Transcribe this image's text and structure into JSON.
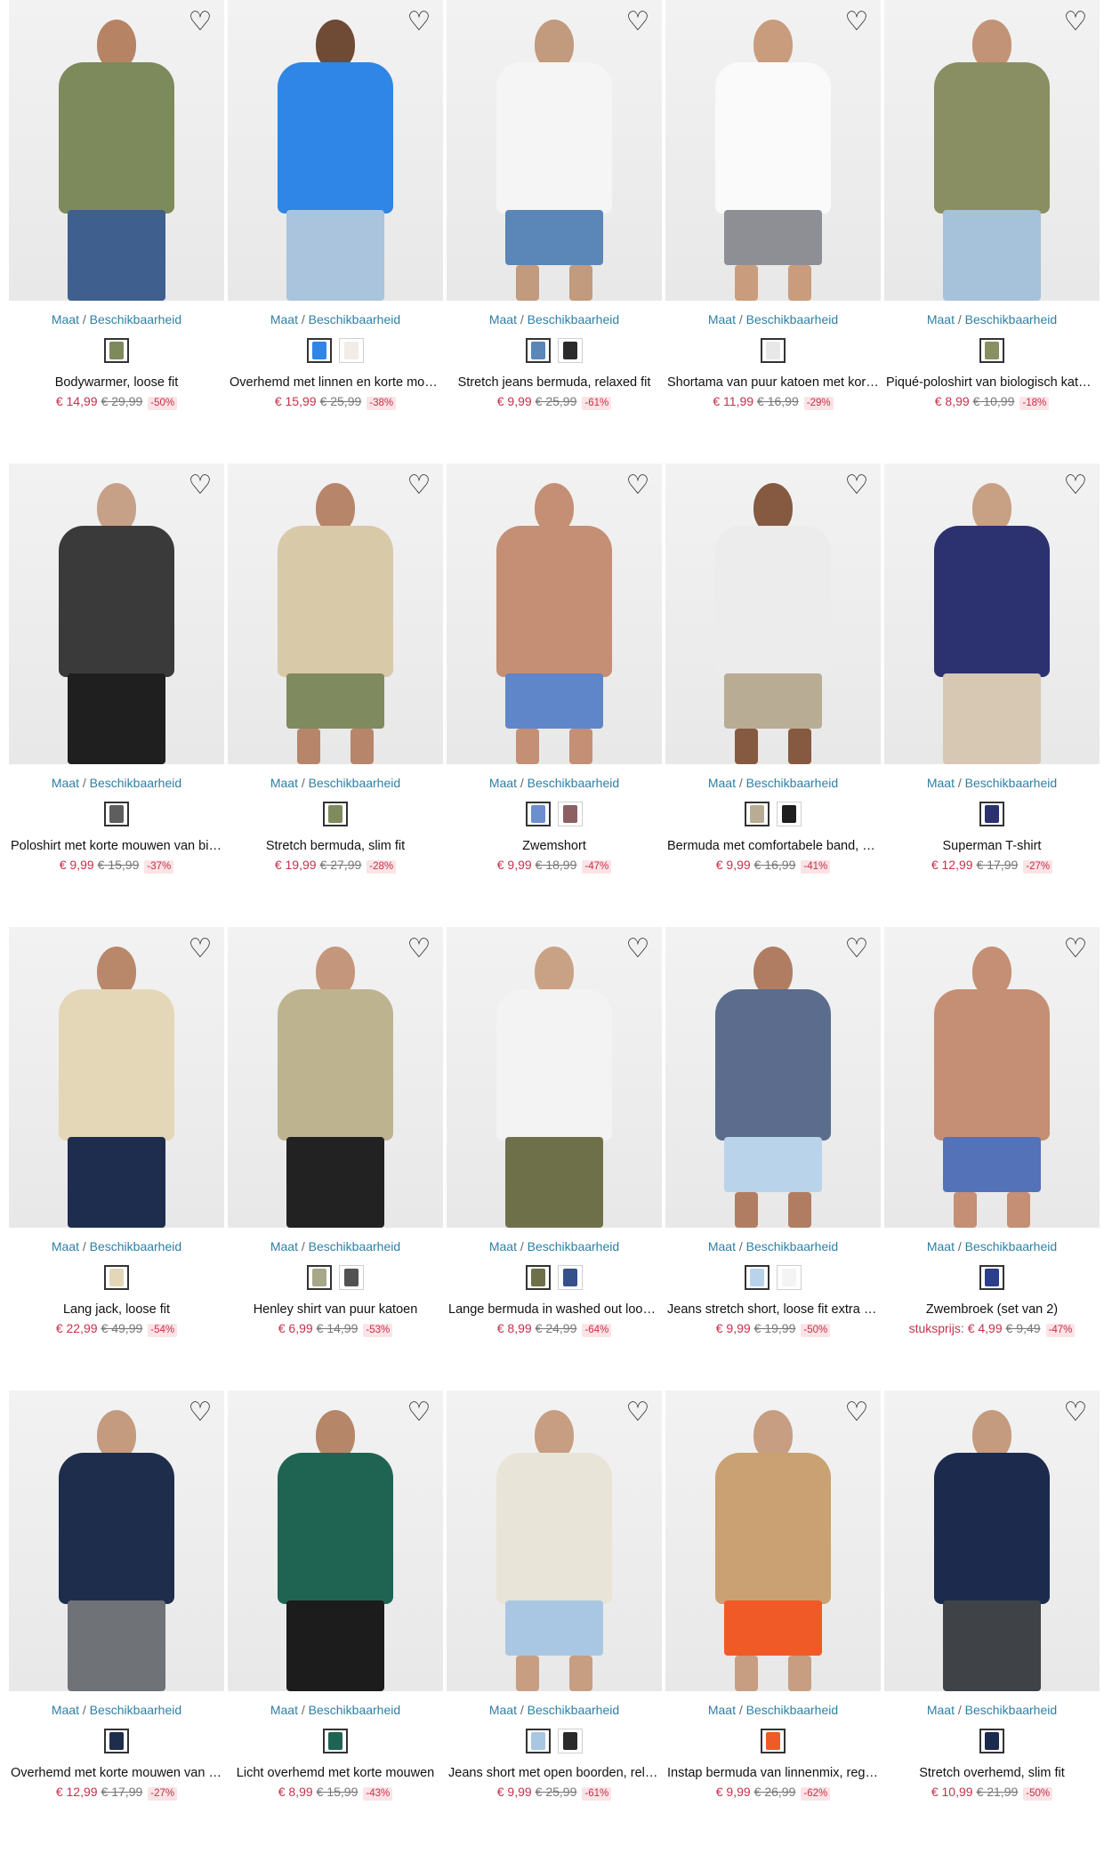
{
  "ui": {
    "size_link": "Maat",
    "size_sep": "/",
    "avail_link": "Beschikbaarheid",
    "currency": "€",
    "favorite_icon": "heart-outline-icon"
  },
  "products": [
    {
      "title": "Bodywarmer, loose fit",
      "price": "€ 14,99",
      "old": "€ 29,99",
      "disc": "-50%",
      "skin": "#b68465",
      "top": "#7d8a5c",
      "bottom": "#3f5f8f",
      "swatches": [
        "#7d8a5c"
      ]
    },
    {
      "title": "Overhemd met linnen en korte mouwen",
      "price": "€ 15,99",
      "old": "€ 25,99",
      "disc": "-38%",
      "skin": "#6f4a35",
      "top": "#2f86e6",
      "bottom": "#a9c4dc",
      "swatches": [
        "#2f86e6",
        "#f1ede6"
      ]
    },
    {
      "title": "Stretch jeans bermuda, relaxed fit",
      "price": "€ 9,99",
      "old": "€ 25,99",
      "disc": "-61%",
      "skin": "#c29a7d",
      "top": "#f5f5f5",
      "bottom": "#5a86b8",
      "swatches": [
        "#5a86b8",
        "#2b2b2b"
      ]
    },
    {
      "title": "Shortama van puur katoen met korte mouwen",
      "price": "€ 11,99",
      "old": "€ 16,99",
      "disc": "-29%",
      "skin": "#c99c7d",
      "top": "#fafafa",
      "bottom": "#8d8f94",
      "swatches": [
        "#e8e8e8"
      ]
    },
    {
      "title": "Piqué-poloshirt van biologisch katoen",
      "price": "€ 8,99",
      "old": "€ 10,99",
      "disc": "-18%",
      "skin": "#c39378",
      "top": "#8a8f63",
      "bottom": "#a6c1da",
      "swatches": [
        "#8a8f63"
      ]
    },
    {
      "title": "Poloshirt met korte mouwen van biologisch katoen",
      "price": "€ 9,99",
      "old": "€ 15,99",
      "disc": "-37%",
      "skin": "#c7a088",
      "top": "#3a3a3a",
      "bottom": "#1f1f1f",
      "swatches": [
        "#5e5e5e"
      ]
    },
    {
      "title": "Stretch bermuda, slim fit",
      "price": "€ 19,99",
      "old": "€ 27,99",
      "disc": "-28%",
      "skin": "#b7856a",
      "top": "#d8c9a8",
      "bottom": "#7f8a5e",
      "swatches": [
        "#7f8a5e"
      ]
    },
    {
      "title": "Zwemshort",
      "price": "€ 9,99",
      "old": "€ 18,99",
      "disc": "-47%",
      "skin": "#c48f74",
      "top": "#c48f74",
      "bottom": "#5f86c8",
      "swatches": [
        "#6e8fcd",
        "#8c5f63"
      ]
    },
    {
      "title": "Bermuda met comfortabele band, regular fit",
      "price": "€ 9,99",
      "old": "€ 16,99",
      "disc": "-41%",
      "skin": "#855a40",
      "top": "#ececec",
      "bottom": "#b8ac94",
      "swatches": [
        "#b8ac94",
        "#1e1e1e"
      ]
    },
    {
      "title": "Superman T-shirt",
      "price": "€ 12,99",
      "old": "€ 17,99",
      "disc": "-27%",
      "skin": "#c8a084",
      "top": "#2c3170",
      "bottom": "#d6c8b2",
      "swatches": [
        "#2c3170"
      ]
    },
    {
      "title": "Lang jack, loose fit",
      "price": "€ 22,99",
      "old": "€ 49,99",
      "disc": "-54%",
      "skin": "#b9876a",
      "top": "#e4d7b8",
      "bottom": "#1e2c4e",
      "swatches": [
        "#e4d7b8"
      ]
    },
    {
      "title": "Henley shirt van puur katoen",
      "price": "€ 6,99",
      "old": "€ 14,99",
      "disc": "-53%",
      "skin": "#c4977c",
      "top": "#bdb48f",
      "bottom": "#222222",
      "swatches": [
        "#a7a78a",
        "#525252"
      ]
    },
    {
      "title": "Lange bermuda in washed out look, regular fit",
      "price": "€ 8,99",
      "old": "€ 24,99",
      "disc": "-64%",
      "skin": "#c9a286",
      "top": "#f3f3f3",
      "bottom": "#6e7049",
      "swatches": [
        "#6e7049",
        "#35508a"
      ]
    },
    {
      "title": "Jeans stretch short, loose fit extra wijd",
      "price": "€ 9,99",
      "old": "€ 19,99",
      "disc": "-50%",
      "skin": "#b17d62",
      "top": "#5b6c8d",
      "bottom": "#b8d3ea",
      "swatches": [
        "#b8d3ea",
        "#f4f4f4"
      ]
    },
    {
      "title": "Zwembroek (set van 2)",
      "price": "€ 4,99",
      "old": "€ 9,49",
      "disc": "-47%",
      "unit": "stuksprijs:",
      "skin": "#c48f74",
      "top": "#c48f74",
      "bottom": "#5472b8",
      "swatches": [
        "#2b3f8a"
      ]
    },
    {
      "title": "Overhemd met korte mouwen van puur katoen",
      "price": "€ 12,99",
      "old": "€ 17,99",
      "disc": "-27%",
      "skin": "#c49b7e",
      "top": "#1f2d4c",
      "bottom": "#6f7276",
      "swatches": [
        "#1f2d4c"
      ]
    },
    {
      "title": "Licht overhemd met korte mouwen",
      "price": "€ 8,99",
      "old": "€ 15,99",
      "disc": "-43%",
      "skin": "#b68668",
      "top": "#1f6453",
      "bottom": "#1c1c1c",
      "swatches": [
        "#1f6453"
      ]
    },
    {
      "title": "Jeans short met open boorden, relaxed fit",
      "price": "€ 9,99",
      "old": "€ 25,99",
      "disc": "-61%",
      "skin": "#c79e82",
      "top": "#e9e4d8",
      "bottom": "#a9c7e2",
      "swatches": [
        "#a9c7e2",
        "#2a2a2a"
      ]
    },
    {
      "title": "Instap bermuda van linnenmix, regular fit",
      "price": "€ 9,99",
      "old": "€ 26,99",
      "disc": "-62%",
      "skin": "#c79e82",
      "top": "#c9a172",
      "bottom": "#ef5a26",
      "swatches": [
        "#ef5a26"
      ]
    },
    {
      "title": "Stretch overhemd, slim fit",
      "price": "€ 10,99",
      "old": "€ 21,99",
      "disc": "-50%",
      "skin": "#c49b7e",
      "top": "#1c2a4e",
      "bottom": "#3f4348",
      "swatches": [
        "#1c2a4e"
      ]
    }
  ]
}
